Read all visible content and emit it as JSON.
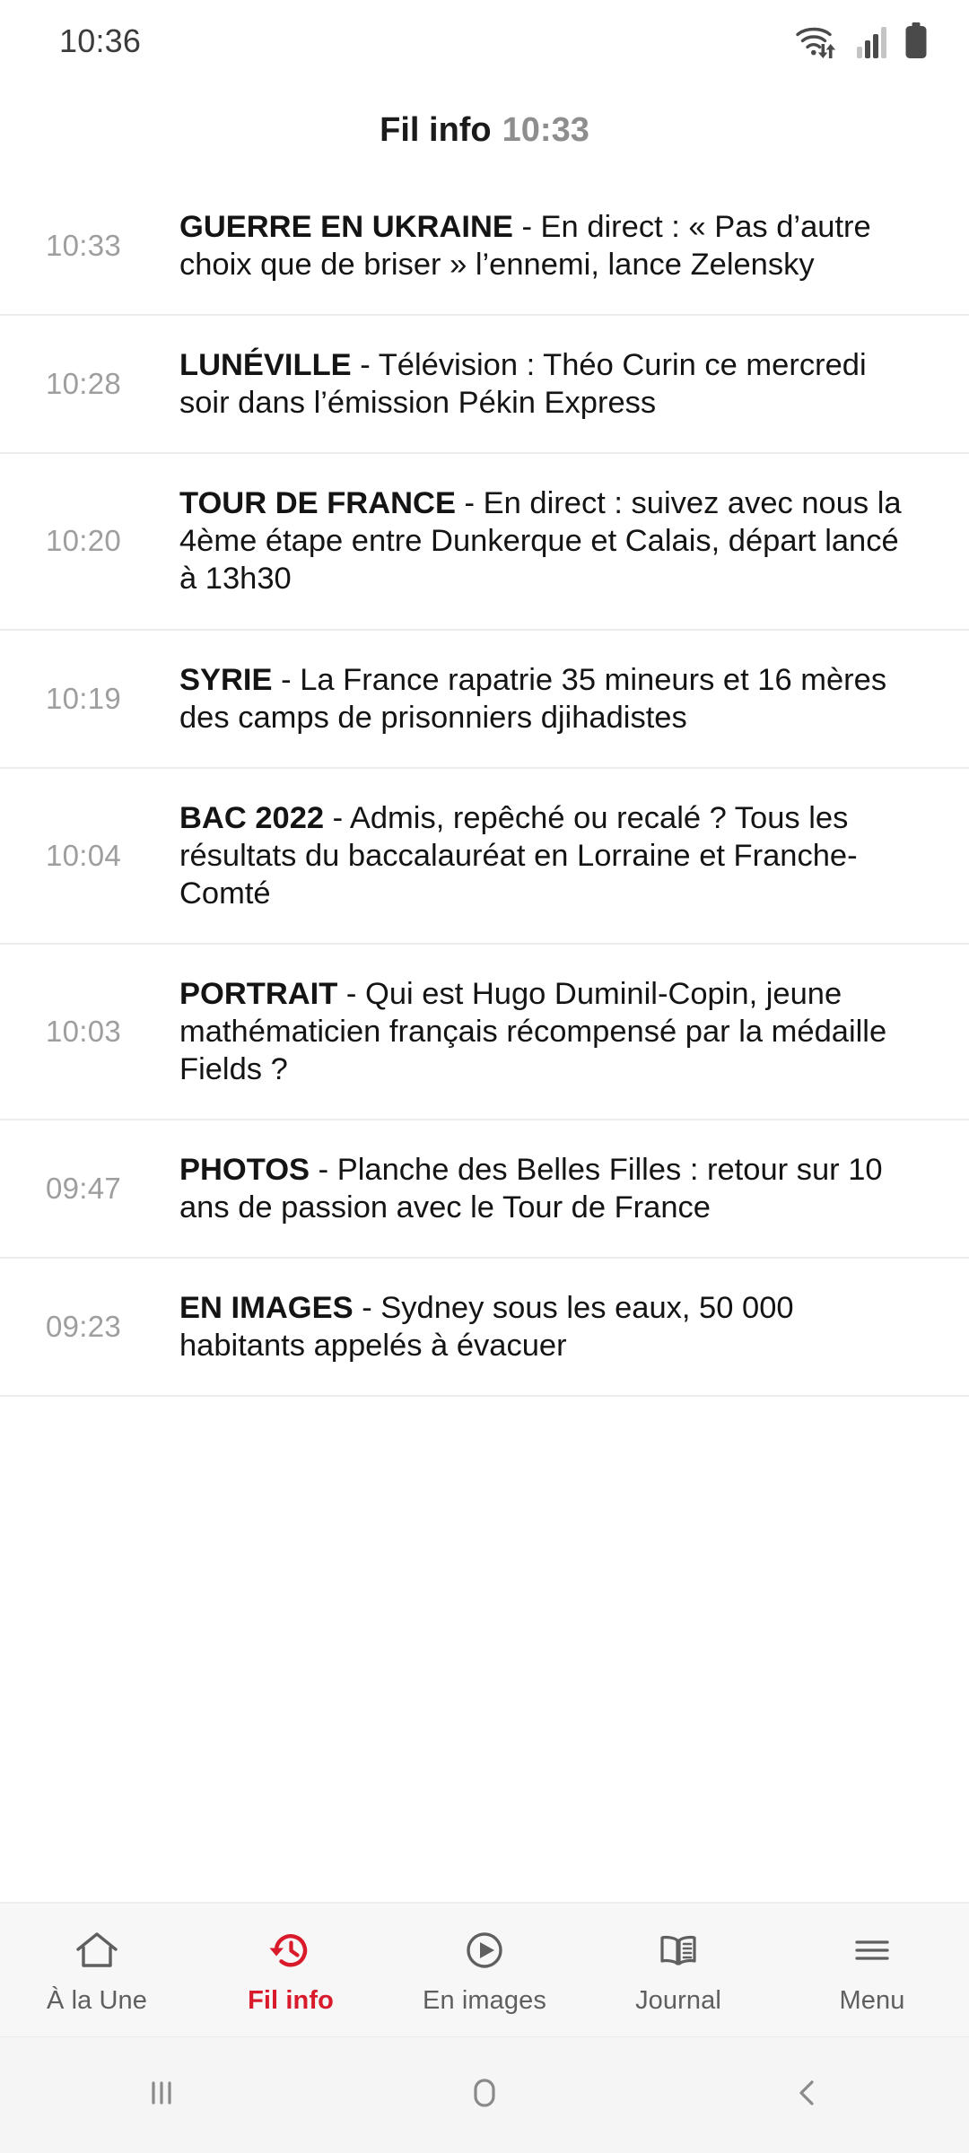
{
  "status_bar": {
    "clock": "10:36",
    "icons": [
      "wifi-transfer-icon",
      "signal-bars-icon",
      "battery-full-icon"
    ]
  },
  "header": {
    "title": "Fil info",
    "time": "10:33"
  },
  "feed": {
    "items": [
      {
        "time": "10:33",
        "kicker": "GUERRE EN UKRAINE",
        "rest": " - En direct : « Pas d’autre choix que de briser » l’ennemi, lance Zelensky"
      },
      {
        "time": "10:28",
        "kicker": "LUNÉVILLE",
        "rest": " - Télévision : Théo Curin ce mercredi soir dans l’émission Pékin Express"
      },
      {
        "time": "10:20",
        "kicker": "TOUR DE FRANCE",
        "rest": " - En direct : suivez avec nous la 4ème étape entre Dunkerque et Calais, départ lancé à 13h30"
      },
      {
        "time": "10:19",
        "kicker": "SYRIE",
        "rest": " - La France rapatrie 35 mineurs et 16 mères des camps de prisonniers djihadistes"
      },
      {
        "time": "10:04",
        "kicker": "BAC 2022",
        "rest": " - Admis, repêché ou recalé ? Tous les résultats du baccalauréat en Lorraine et Franche-Comté"
      },
      {
        "time": "10:03",
        "kicker": "PORTRAIT",
        "rest": " - Qui est Hugo Duminil-Copin, jeune mathématicien français récompensé par la médaille Fields ?"
      },
      {
        "time": "09:47",
        "kicker": "PHOTOS",
        "rest": " - Planche des Belles Filles : retour sur 10 ans de passion avec le Tour de France"
      },
      {
        "time": "09:23",
        "kicker": "EN IMAGES",
        "rest": " - Sydney sous les eaux, 50 000 habitants appelés à évacuer"
      }
    ]
  },
  "tabbar": {
    "active_index": 1,
    "active_color": "#d81a2a",
    "inactive_color": "#5f5f5f",
    "items": [
      {
        "label": "À la Une",
        "icon": "home-icon"
      },
      {
        "label": "Fil info",
        "icon": "history-clock-icon"
      },
      {
        "label": "En images",
        "icon": "play-circle-icon"
      },
      {
        "label": "Journal",
        "icon": "open-book-icon"
      },
      {
        "label": "Menu",
        "icon": "hamburger-menu-icon"
      }
    ]
  },
  "system_nav": {
    "buttons": [
      "recents-icon",
      "home-circle-icon",
      "back-chevron-icon"
    ]
  }
}
